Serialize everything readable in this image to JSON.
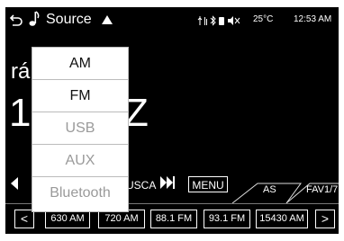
{
  "status_bar": {
    "source_label": "Source",
    "temperature": "25°C",
    "time": "12:53 AM"
  },
  "display": {
    "station_name_partial": "rá",
    "frequency_partial_left": "1",
    "frequency_partial_right": "Z"
  },
  "controls": {
    "seek_label": "BUSCA",
    "menu_label": "MENU",
    "as_tab": "AS",
    "fav_tab": "FAV1/7"
  },
  "presets": [
    "630 AM",
    "720 AM",
    "88.1 FM",
    "93.1 FM",
    "15430 AM"
  ],
  "preset_prev": "<",
  "preset_next": ">",
  "source_menu": {
    "items": [
      {
        "label": "AM",
        "enabled": true
      },
      {
        "label": "FM",
        "enabled": true
      },
      {
        "label": "USB",
        "enabled": false
      },
      {
        "label": "AUX",
        "enabled": false
      },
      {
        "label": "Bluetooth",
        "enabled": false
      }
    ]
  }
}
